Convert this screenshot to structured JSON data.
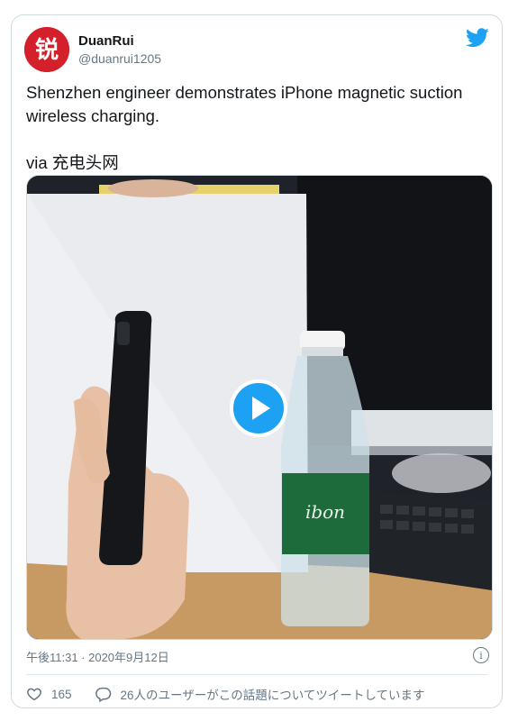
{
  "tweet": {
    "author_name": "DuanRui",
    "author_handle": "@duanrui1205",
    "avatar_glyph": "锐",
    "text_line": "Shenzhen engineer demonstrates iPhone magnetic suction wireless charging.",
    "via_text": "via 充电头网",
    "timestamp": "午後11:31 · 2020年9月12日",
    "likes": "165",
    "replies_text": "26人のユーザーがこの話題についてツイートしています"
  },
  "icons": {
    "bird": "twitter-bird-icon",
    "play": "play-icon",
    "info": "info-icon",
    "heart": "heart-icon",
    "reply": "speech-bubble-icon"
  },
  "colors": {
    "accent": "#1da1f2",
    "avatar_bg": "#d4202a",
    "muted": "#657786"
  }
}
